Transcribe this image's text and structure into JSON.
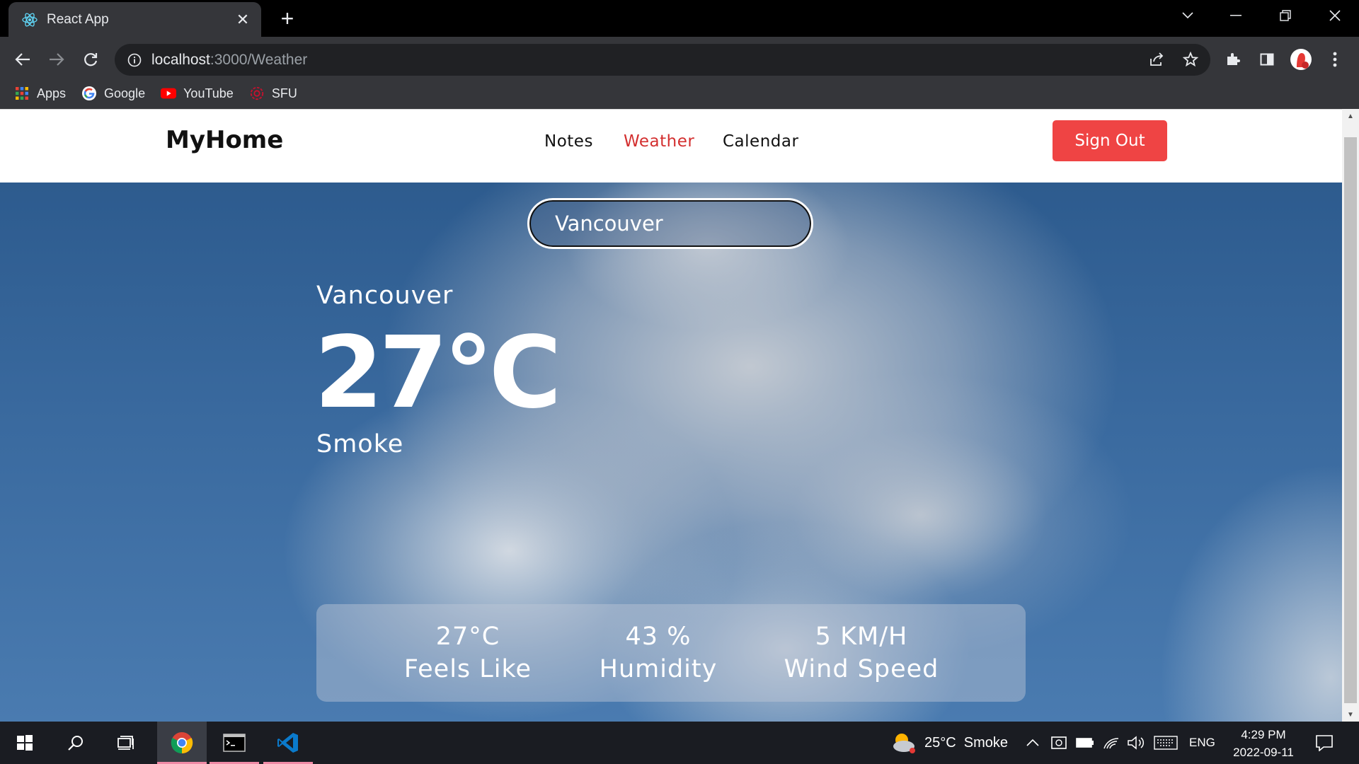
{
  "browser": {
    "tab_title": "React App",
    "url_host": "localhost",
    "url_path": ":3000/Weather",
    "bookmarks": [
      {
        "label": "Apps",
        "icon": "apps-grid-icon"
      },
      {
        "label": "Google",
        "icon": "google-icon"
      },
      {
        "label": "YouTube",
        "icon": "youtube-icon"
      },
      {
        "label": "SFU",
        "icon": "sfu-icon"
      }
    ]
  },
  "navbar": {
    "brand": "MyHome",
    "links": [
      "Notes",
      "Weather",
      "Calendar"
    ],
    "active_link": "Weather",
    "sign_out": "Sign Out"
  },
  "weather": {
    "search_value": "Vancouver",
    "city": "Vancouver",
    "temperature": "27°C",
    "description": "Smoke",
    "stats": [
      {
        "value": "27°C",
        "label": "Feels Like"
      },
      {
        "value": "43 %",
        "label": "Humidity"
      },
      {
        "value": "5 KM/H",
        "label": "Wind Speed"
      }
    ]
  },
  "taskbar": {
    "weather_widget": "25°C  Smoke",
    "language": "ENG",
    "time": "4:29 PM",
    "date": "2022-09-11"
  },
  "colors": {
    "accent": "#ef4444",
    "active_link": "#d32f2f",
    "sky": "#2d5b8e"
  }
}
